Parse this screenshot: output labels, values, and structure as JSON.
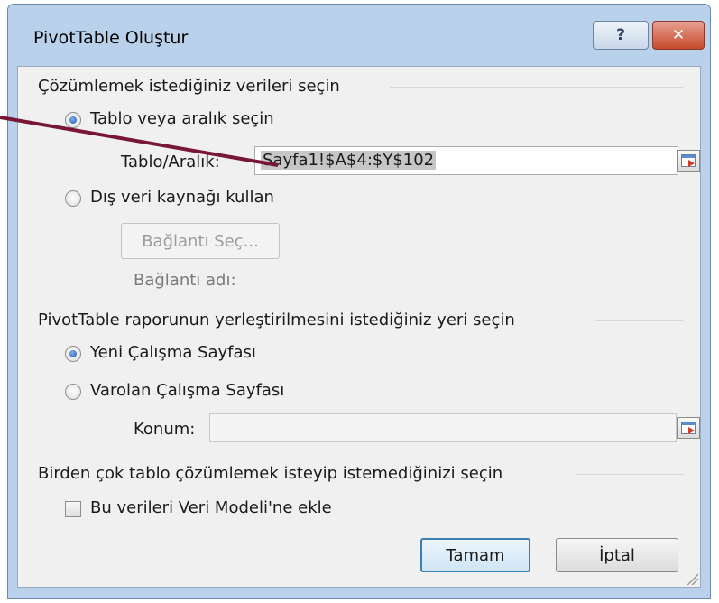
{
  "window": {
    "title": "PivotTable Oluştur",
    "help_label": "?",
    "close_label": "✕"
  },
  "source_group": {
    "title": "Çözümlemek istediğiniz verileri seçin",
    "option_table": "Tablo veya aralık seçin",
    "table_range_label": "Tablo/Aralık:",
    "table_range_value": "Sayfa1!$A$4:$Y$102",
    "option_external": "Dış veri kaynağı kullan",
    "choose_connection": "Bağlantı Seç...",
    "connection_name_label": "Bağlantı adı:"
  },
  "location_group": {
    "title": "PivotTable raporunun yerleştirilmesini istediğiniz yeri seçin",
    "option_new": "Yeni Çalışma Sayfası",
    "option_existing": "Varolan Çalışma Sayfası",
    "location_label": "Konum:",
    "location_value": ""
  },
  "multi_group": {
    "title": "Birden çok tablo çözümlemek isteyip istemediğinizi seçin",
    "data_model_checkbox": "Bu verileri Veri Modeli'ne ekle",
    "data_model_checked": false
  },
  "footer": {
    "ok_label": "Tamam",
    "cancel_label": "İptal"
  },
  "colors": {
    "annotation_line": "#7a1635",
    "radio_selected": "#1e58a8",
    "default_button_border": "#3c7fb1"
  }
}
